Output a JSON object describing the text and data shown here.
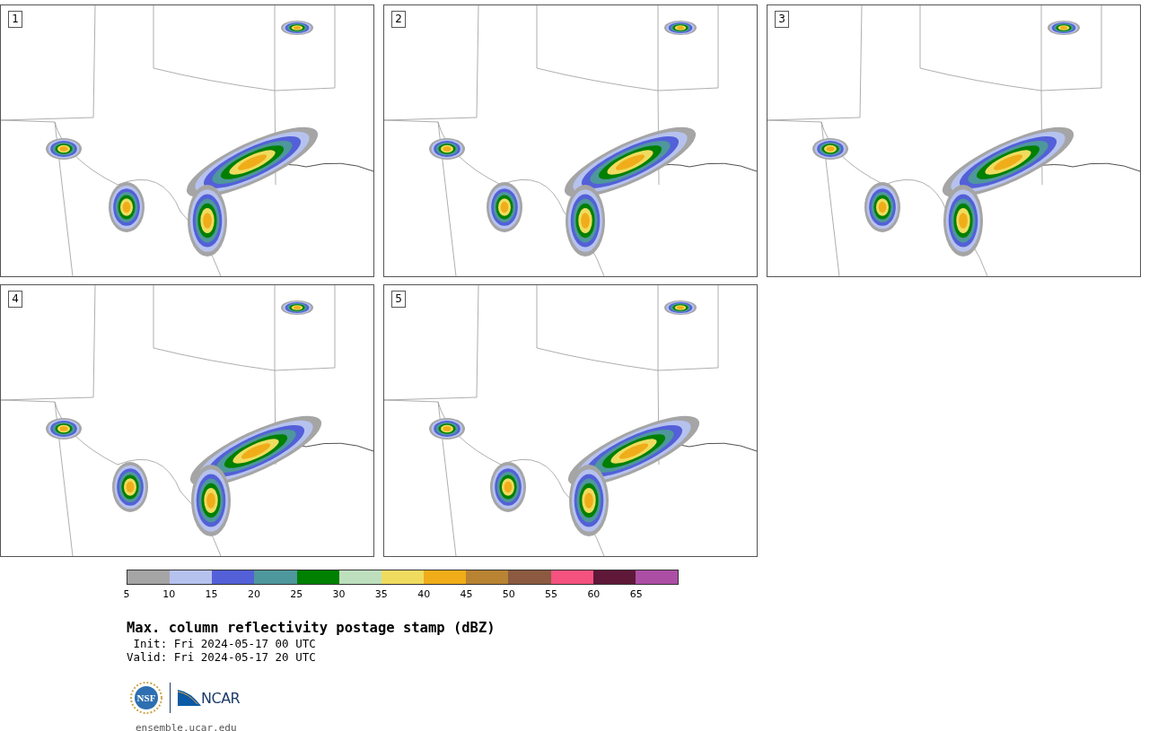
{
  "panels": [
    {
      "number": "1"
    },
    {
      "number": "2"
    },
    {
      "number": "3"
    },
    {
      "number": "4"
    },
    {
      "number": "5"
    }
  ],
  "colorbar": {
    "segments": [
      {
        "color": "#a5a5a5"
      },
      {
        "color": "#b6c2ee"
      },
      {
        "color": "#5360d8"
      },
      {
        "color": "#4e979c"
      },
      {
        "color": "#008000"
      },
      {
        "color": "#bedfbe"
      },
      {
        "color": "#efdc5f"
      },
      {
        "color": "#f0ad19"
      },
      {
        "color": "#b88333"
      },
      {
        "color": "#8b5a40"
      },
      {
        "color": "#f5527f"
      },
      {
        "color": "#5f1838"
      },
      {
        "color": "#ad4ea5"
      }
    ],
    "ticks": [
      "5",
      "10",
      "15",
      "20",
      "25",
      "30",
      "35",
      "40",
      "45",
      "50",
      "55",
      "60",
      "65"
    ]
  },
  "title": "Max. column reflectivity postage stamp (dBZ)",
  "init": " Init: Fri 2024-05-17 00 UTC",
  "valid": "Valid: Fri 2024-05-17 20 UTC",
  "logo": {
    "nsf": "NSF",
    "ncar": "NCAR"
  },
  "site": "ensemble.ucar.edu"
}
